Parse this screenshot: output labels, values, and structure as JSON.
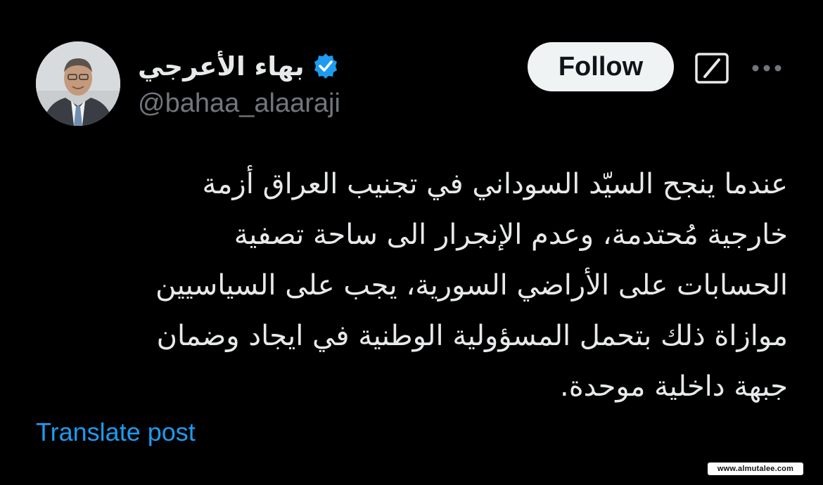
{
  "author": {
    "display_name": "بهاء الأعرجي",
    "handle": "@bahaa_alaaraji",
    "verified": true,
    "avatar_icon": "profile-photo"
  },
  "actions": {
    "follow_label": "Follow",
    "grok_icon": "grok-icon",
    "more_icon": "more-options-icon"
  },
  "tweet": {
    "lines": [
      "عندما ينجح السيّد السوداني في تجنيب العراق أزمة",
      "خارجية مُحتدمة، وعدم الإنجرار الى ساحة تصفية",
      "الحسابات على الأراضي السورية، يجب على السياسيين",
      "موازاة ذلك بتحمل المسؤولية الوطنية في ايجاد وضمان",
      "جبهة داخلية موحدة."
    ]
  },
  "translate_label": "Translate post",
  "watermark": "www.almutalee.com",
  "colors": {
    "background": "#000000",
    "text_primary": "#e7e9ea",
    "text_secondary": "#71767b",
    "link": "#1d9bf0",
    "verified_badge": "#1d9bf0",
    "follow_bg": "#eff3f4"
  }
}
